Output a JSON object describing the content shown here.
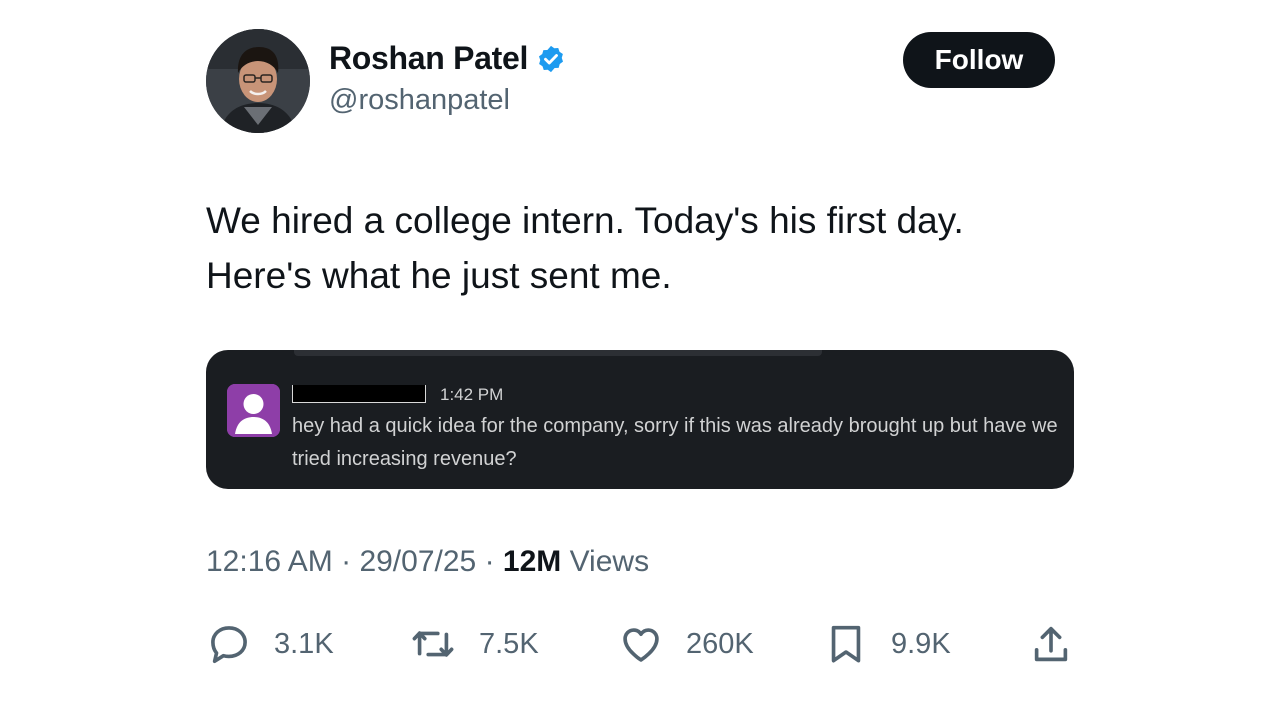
{
  "author": {
    "display_name": "Roshan Patel",
    "handle": "@roshanpatel",
    "verified": true
  },
  "follow_button": {
    "label": "Follow"
  },
  "tweet": {
    "lines": [
      "We hired a college intern. Today's his first day.",
      "Here's what he just sent me."
    ]
  },
  "embedded_message": {
    "time": "1:42 PM",
    "text": "hey had a quick idea for the company, sorry if this was already brought up but have we tried increasing revenue?"
  },
  "meta": {
    "time": "12:16 AM",
    "date": "29/07/25",
    "views_count": "12M",
    "views_label": "Views"
  },
  "actions": {
    "replies": "3.1K",
    "reposts": "7.5K",
    "likes": "260K",
    "bookmarks": "9.9K"
  },
  "icons": {
    "verified": "verified-badge-icon",
    "reply": "reply-icon",
    "repost": "repost-icon",
    "like": "heart-icon",
    "bookmark": "bookmark-icon",
    "share": "share-icon"
  },
  "colors": {
    "verified_blue": "#1d9bf0",
    "text_primary": "#0f1419",
    "text_secondary": "#536471",
    "follow_bg": "#0f1419",
    "embed_bg": "#1a1d21",
    "slack_avatar": "#8e3ea8"
  }
}
